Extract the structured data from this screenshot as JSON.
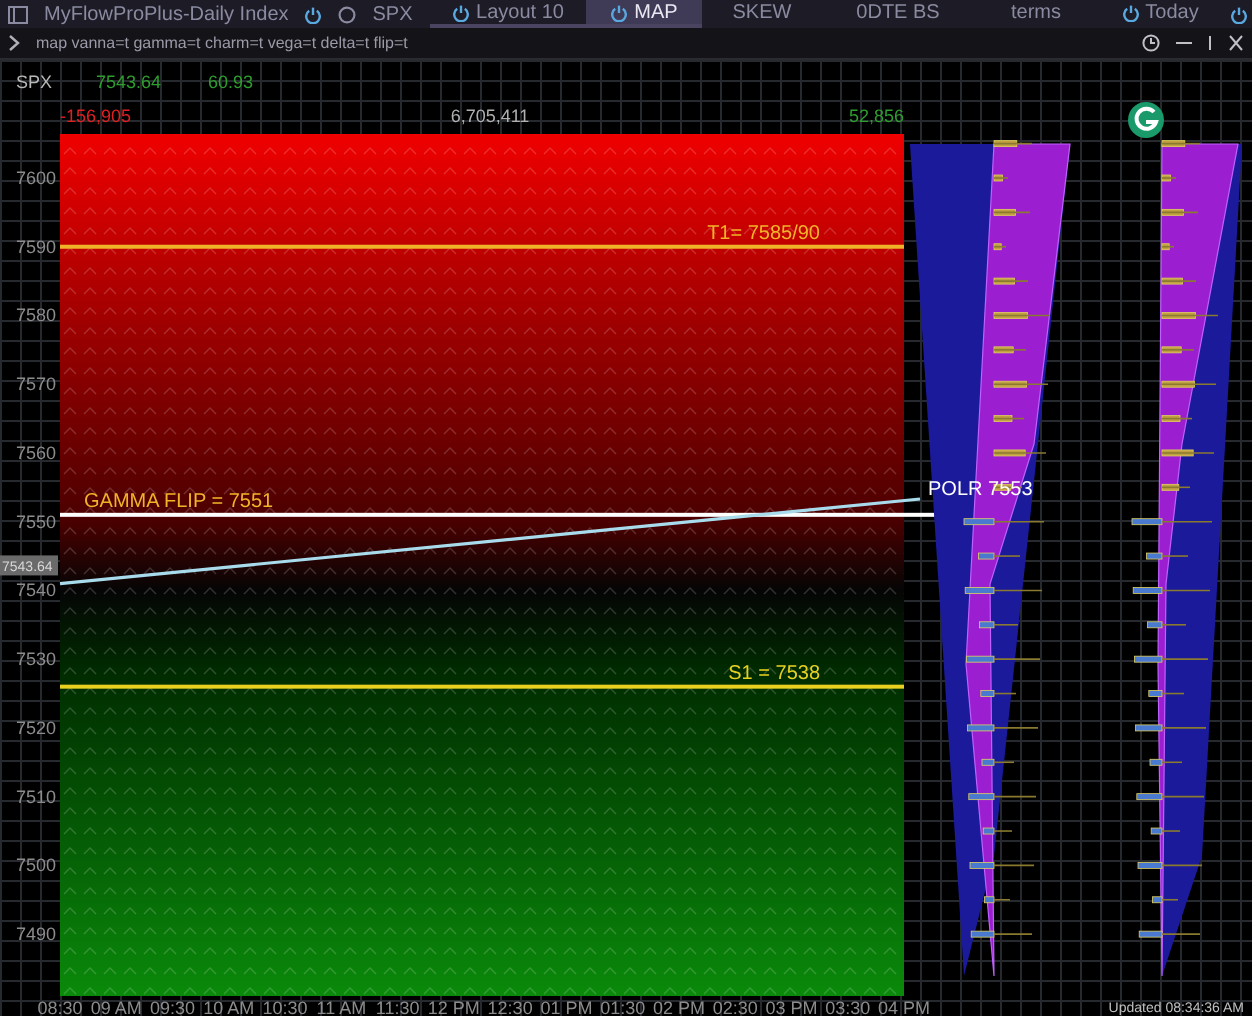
{
  "window": {
    "title": "MyFlowProPlus-Daily Index",
    "symbol": "SPX"
  },
  "tabs": [
    {
      "label": "Layout 10",
      "selected": false,
      "power": true
    },
    {
      "label": "MAP",
      "selected": true,
      "power": true
    },
    {
      "label": "SKEW",
      "selected": false,
      "power": false
    },
    {
      "label": "0DTE BS",
      "selected": false,
      "power": false
    },
    {
      "label": "terms",
      "selected": false,
      "power": false
    },
    {
      "label": "Today",
      "selected": false,
      "power": true
    }
  ],
  "command": {
    "text": "map vanna=t gamma=t charm=t vega=t delta=t flip=t"
  },
  "quote": {
    "symbol": "SPX",
    "price": "7543.64",
    "change": "60.93"
  },
  "totals": [
    {
      "value": "-156,905",
      "color": "#e02020"
    },
    {
      "value": "6,705,411",
      "color": "#b0b0b0"
    },
    {
      "value": "52,856",
      "color": "#2e9e2e"
    }
  ],
  "price_tag": "7543.64",
  "price_axis": [
    "7600",
    "7590",
    "7580",
    "7570",
    "7560",
    "7550",
    "7540",
    "7530",
    "7520",
    "7510",
    "7500",
    "7490"
  ],
  "time_axis": [
    "08:30",
    "09 AM",
    "09:30",
    "10 AM",
    "10:30",
    "11 AM",
    "11:30",
    "12 PM",
    "12:30",
    "01 PM",
    "01:30",
    "02 PM",
    "02:30",
    "03 PM",
    "03:30",
    "04 PM"
  ],
  "levels": [
    {
      "label": "T1= 7585/90",
      "color": "#f0b429"
    },
    {
      "label": "GAMMA FLIP = 7551",
      "color": "#ffffff"
    },
    {
      "label": "S1 = 7538",
      "color": "#e8d020"
    }
  ],
  "polr_label": "POLR 7553",
  "updated": "Updated 08:34:36 AM"
}
